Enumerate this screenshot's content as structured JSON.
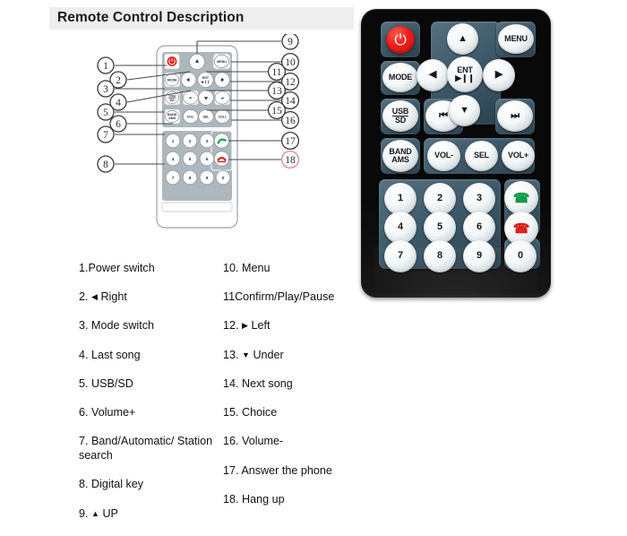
{
  "header": {
    "title": "Remote Control Description",
    "band_color": "#eeeeee"
  },
  "diagram": {
    "name": "remote-control-callout-diagram",
    "callouts_left": [
      "1",
      "2",
      "3",
      "4",
      "5",
      "6",
      "7",
      "8"
    ],
    "callouts_right": [
      "9",
      "10",
      "11",
      "12",
      "13",
      "14",
      "15",
      "16",
      "17",
      "18"
    ],
    "button_labels": {
      "power": "⏻",
      "mode": "MODE",
      "usb_sd_top": "USB",
      "usb_sd_bottom": "SD",
      "band_top": "BAND",
      "band_bottom": "AMS",
      "up": "▲",
      "down": "▼",
      "left": "◀",
      "right": "▶",
      "ent_top": "ENT",
      "ent_bottom": "▶❙❙",
      "menu": "MENU",
      "prev": "⏮",
      "next": "⏭",
      "vol_down": "VOL-",
      "vol_up": "VOL+",
      "sel": "SEL",
      "answer": "answer-call",
      "hangup": "hang-up-call"
    },
    "keypad": [
      "1",
      "2",
      "3",
      "4",
      "5",
      "6",
      "7",
      "8",
      "9",
      "0"
    ]
  },
  "legend": {
    "left": [
      {
        "num": "1.",
        "text": "Power switch",
        "glyph": ""
      },
      {
        "num": "2.",
        "text": "Right",
        "glyph": "◀"
      },
      {
        "num": "3.",
        "text": "Mode switch",
        "glyph": ""
      },
      {
        "num": "4.",
        "text": "Last song",
        "glyph": ""
      },
      {
        "num": "5.",
        "text": "USB/SD",
        "glyph": ""
      },
      {
        "num": "6.",
        "text": "Volume+",
        "glyph": ""
      },
      {
        "num": "7.",
        "text": "Band/Automatic/ Station search",
        "glyph": ""
      },
      {
        "num": "8.",
        "text": "Digital key",
        "glyph": ""
      },
      {
        "num": "9.",
        "text": "UP",
        "glyph": "▲"
      }
    ],
    "right": [
      {
        "num": "10.",
        "text": "Menu",
        "glyph": ""
      },
      {
        "num": "11",
        "text": "Confirm/Play/Pause",
        "glyph": ""
      },
      {
        "num": "12.",
        "text": "Left",
        "glyph": "▶"
      },
      {
        "num": "13.",
        "text": "Under",
        "glyph": "▼"
      },
      {
        "num": "14.",
        "text": "Next song",
        "glyph": ""
      },
      {
        "num": "15.",
        "text": "Choice",
        "glyph": ""
      },
      {
        "num": "16.",
        "text": "Volume-",
        "glyph": ""
      },
      {
        "num": "17.",
        "text": "Answer the phone",
        "glyph": ""
      },
      {
        "num": "18.",
        "text": "Hang up",
        "glyph": ""
      }
    ]
  },
  "photo": {
    "name": "remote-control-photo",
    "body_color": "#101011",
    "pad_color": "#3e5a6a",
    "power_color": "#ee2018",
    "answer_color": "#0e9a46",
    "hangup_color": "#d8201a",
    "keys": {
      "power": "⏻",
      "up": "▲",
      "menu": "MENU",
      "mode": "MODE",
      "left": "◀",
      "ent_top": "ENT",
      "ent_bottom": "▶❙❙",
      "right": "▶",
      "usb": "USB",
      "sd": "SD",
      "prev": "⏮",
      "down": "▼",
      "next": "⏭",
      "band": "BAND",
      "ams": "AMS",
      "vol_down": "VOL-",
      "sel": "SEL",
      "vol_up": "VOL+",
      "k1": "1",
      "k2": "2",
      "k3": "3",
      "k4": "4",
      "k5": "5",
      "k6": "6",
      "k7": "7",
      "k8": "8",
      "k9": "9",
      "k0": "0"
    }
  }
}
